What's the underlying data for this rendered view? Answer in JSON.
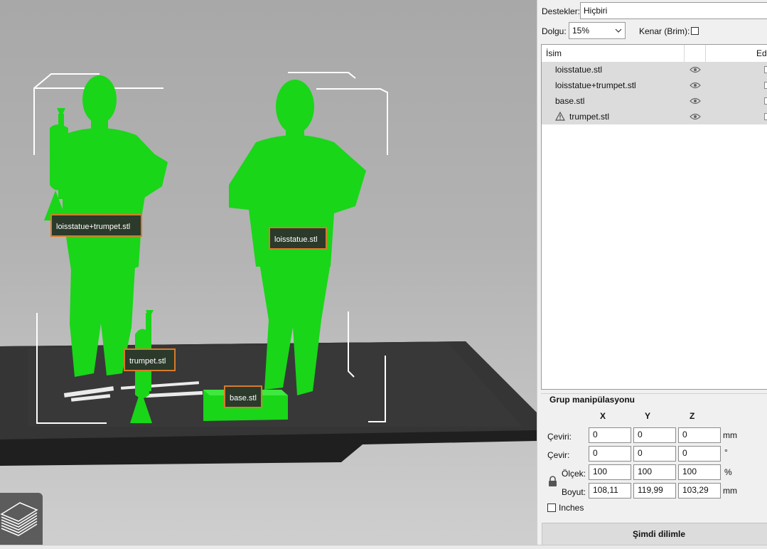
{
  "supports": {
    "label": "Destekler:",
    "value": "Hiçbiri"
  },
  "infill": {
    "label": "Dolgu:",
    "value": "15%"
  },
  "brim": {
    "label": "Kenar (Brim):",
    "checked": false
  },
  "object_list": {
    "col_name": "İsim",
    "col_edit": "Edi",
    "items": [
      {
        "name": "loisstatue.stl",
        "warning": false
      },
      {
        "name": "loisstatue+trumpet.stl",
        "warning": false
      },
      {
        "name": "base.stl",
        "warning": false
      },
      {
        "name": "trumpet.stl",
        "warning": true
      }
    ]
  },
  "group": {
    "title": "Grup manipülasyonu",
    "axes": [
      "X",
      "Y",
      "Z"
    ],
    "rows": [
      {
        "label": "Çeviri:",
        "values": [
          "0",
          "0",
          "0"
        ],
        "unit": "mm"
      },
      {
        "label": "Çevir:",
        "values": [
          "0",
          "0",
          "0"
        ],
        "unit": "°"
      },
      {
        "label": "Ölçek:",
        "values": [
          "100",
          "100",
          "100"
        ],
        "unit": "%"
      },
      {
        "label": "Boyut:",
        "values": [
          "108,11",
          "119,99",
          "103,29"
        ],
        "unit": "mm"
      }
    ],
    "inches_label": "Inches",
    "inches_checked": false
  },
  "slice_button": "Şimdi dilimle",
  "viewport_labels": {
    "statue_trumpet": "loisstatue+trumpet.stl",
    "statue": "loisstatue.stl",
    "trumpet": "trumpet.stl",
    "base": "base.stl"
  },
  "colors": {
    "model": "#19d619",
    "label_border": "#d97a2b",
    "bed": "#2e2e2e"
  }
}
